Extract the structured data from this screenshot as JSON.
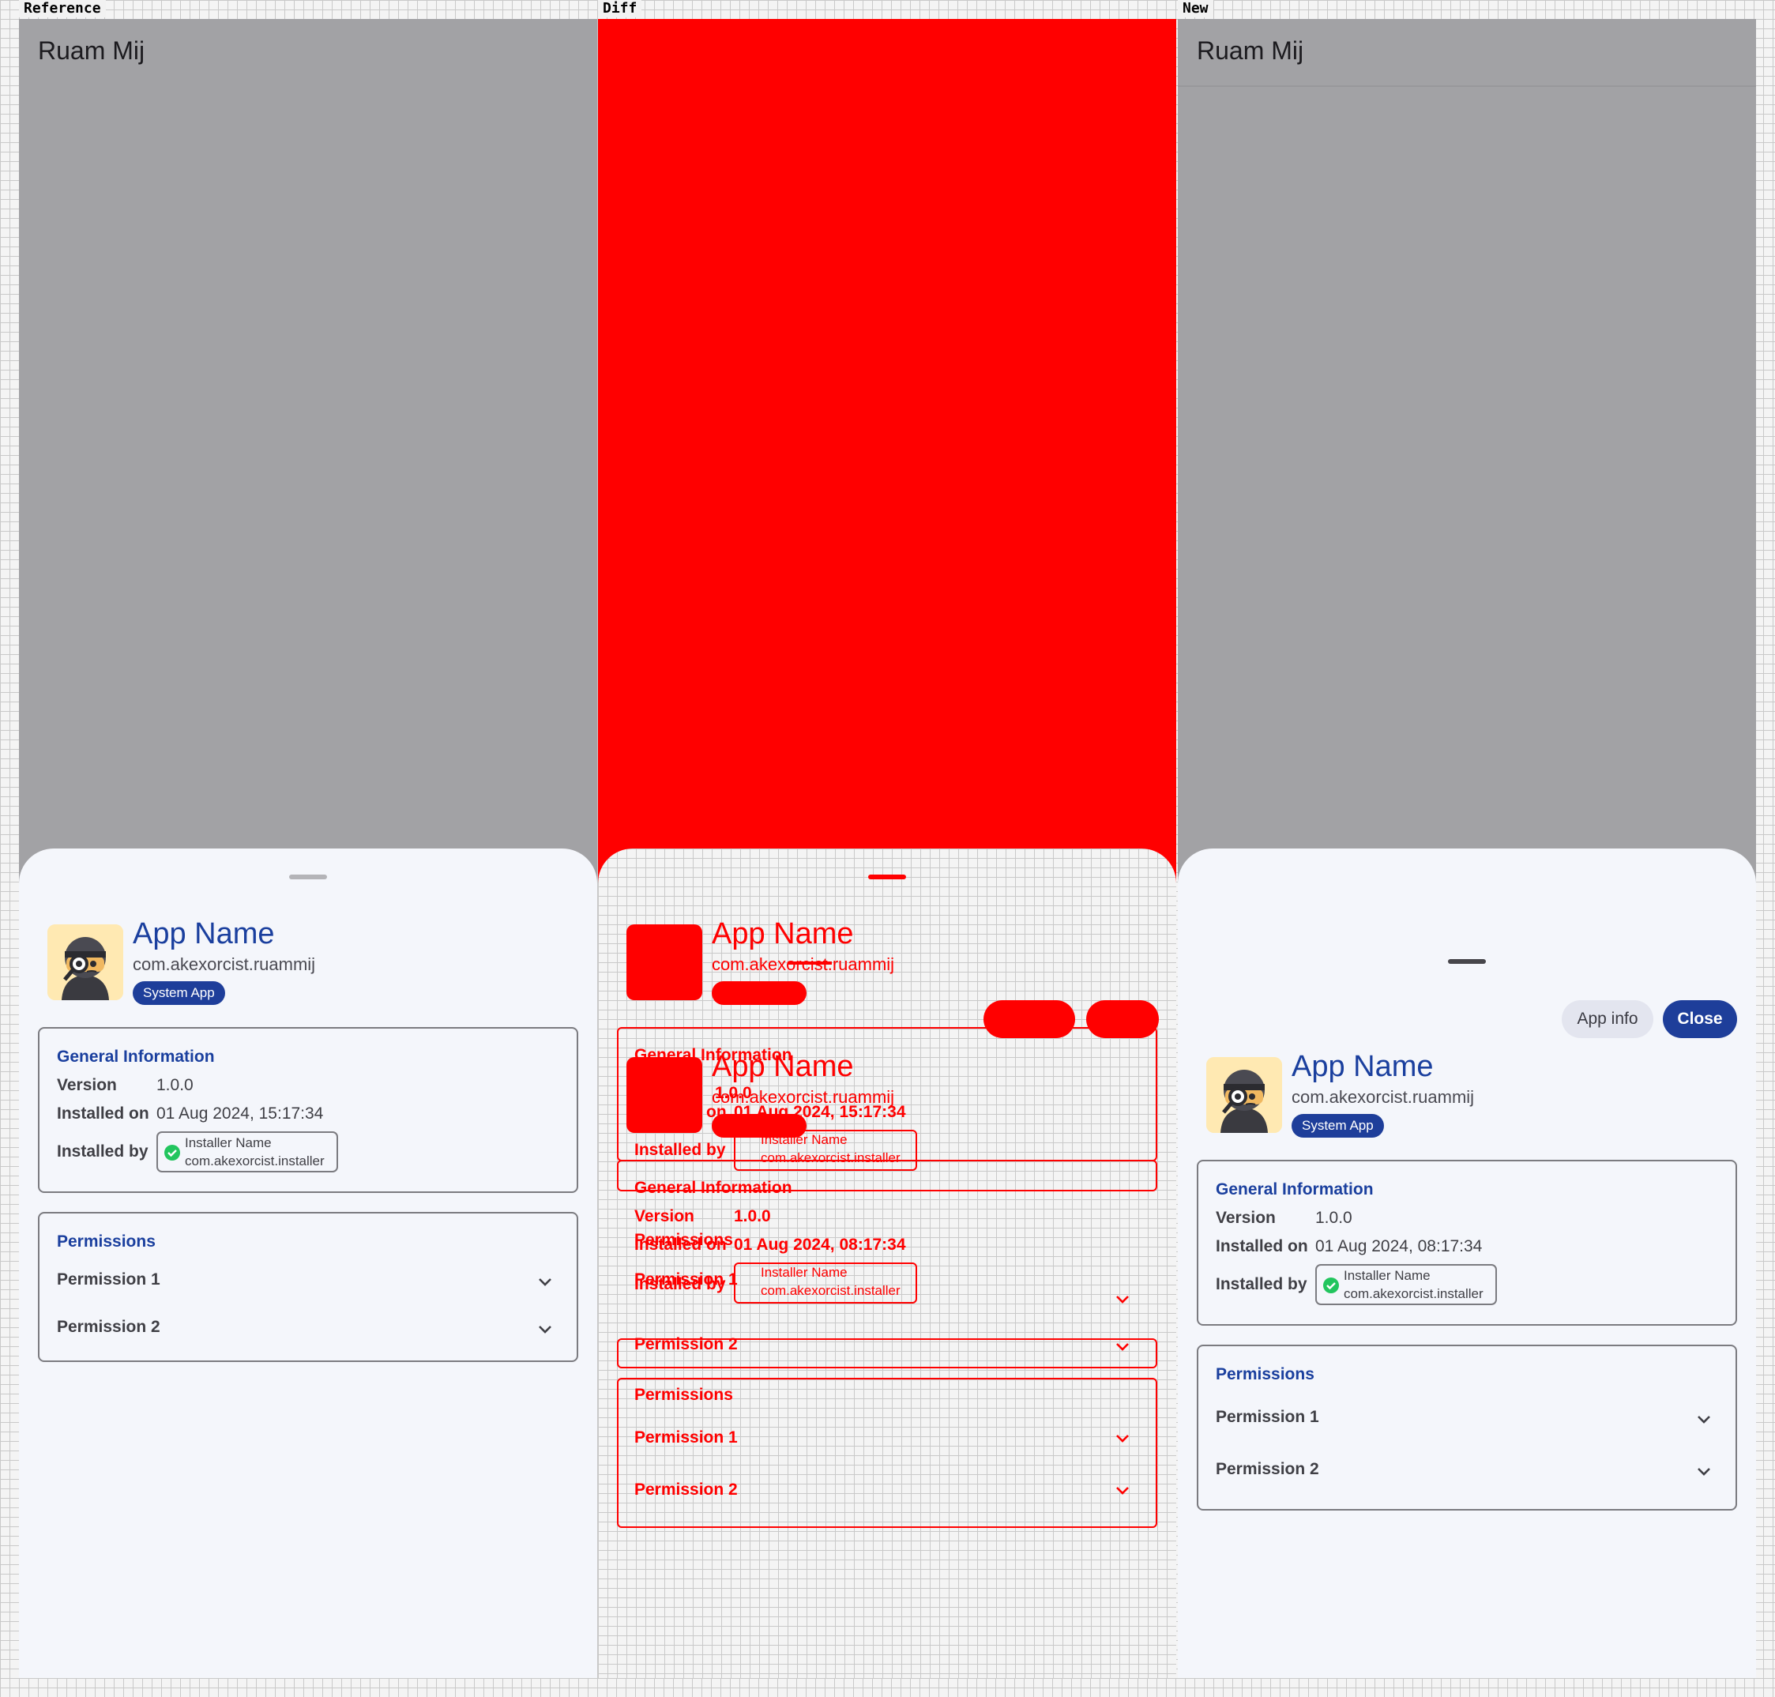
{
  "labels": {
    "reference": "Reference",
    "diff": "Diff",
    "new": "New"
  },
  "app_bar": {
    "title": "Ruam Mij"
  },
  "app": {
    "name": "App Name",
    "package": "com.akexorcist.ruammij",
    "badge": "System App"
  },
  "actions": {
    "app_info": "App info",
    "close": "Close"
  },
  "general_info": {
    "title": "General Information",
    "version_label": "Version",
    "version_value": "1.0.0",
    "installed_on_label": "Installed on",
    "installed_by_label": "Installed by",
    "installer_name": "Installer Name",
    "installer_package": "com.akexorcist.installer"
  },
  "installed_on": {
    "reference": "01 Aug 2024, 15:17:34",
    "new": "01 Aug 2024, 08:17:34"
  },
  "permissions": {
    "title": "Permissions",
    "items": [
      "Permission 1",
      "Permission 2"
    ]
  },
  "colors": {
    "accent": "#1a3f9e",
    "badge": "#1e3e9a",
    "scrim": "#a2a2a5",
    "sheet": "#f4f6fb",
    "diff": "#ff0000",
    "check": "#22c55e"
  },
  "icons": [
    "app-avatar-icon",
    "verified-check-icon",
    "chevron-down-icon",
    "drag-handle-icon"
  ]
}
